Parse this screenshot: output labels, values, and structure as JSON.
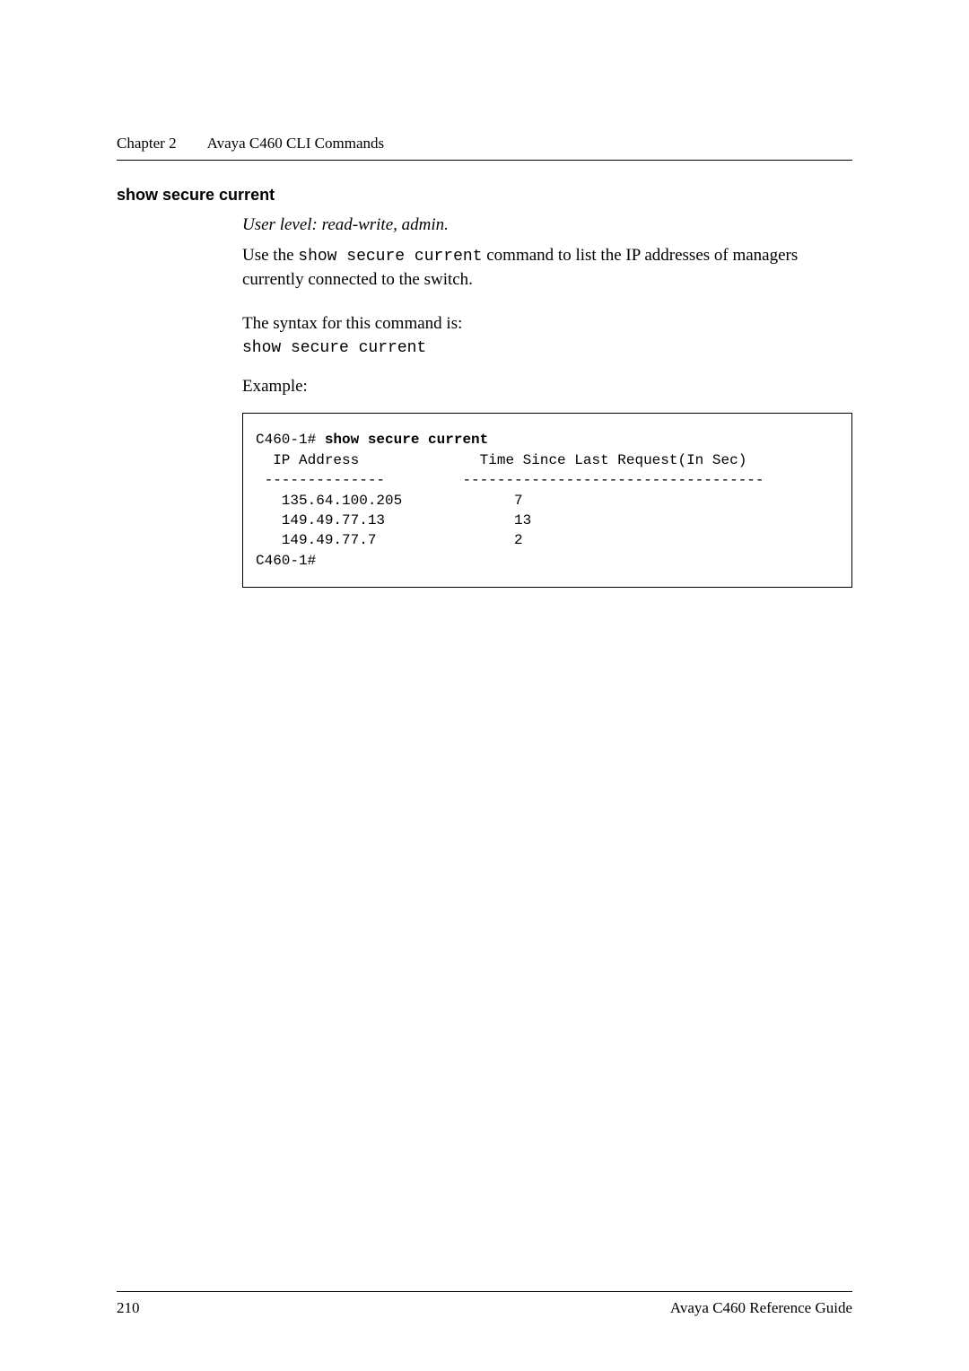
{
  "header": {
    "chapter": "Chapter 2",
    "title": "Avaya C460 CLI Commands"
  },
  "section": {
    "title": "show secure current",
    "user_level": "User level: read-write, admin.",
    "description_pre": "Use the ",
    "description_code": "show secure current",
    "description_post": " command to list the IP addresses of managers currently connected to the switch.",
    "syntax_label": "The syntax for this command is:",
    "syntax_code": "show secure current",
    "example_label": "Example:",
    "example": {
      "prompt1": "C460-1# ",
      "command": "show secure current",
      "col1_header": "  IP Address",
      "col2_header": "Time Since Last Request(In Sec)",
      "div1": " --------------         -----------------------------------",
      "row1": "   135.64.100.205             7",
      "row2": "   149.49.77.13               13",
      "row3": "   149.49.77.7                2",
      "prompt2": "C460-1#"
    }
  },
  "footer": {
    "page": "210",
    "doc": "Avaya C460 Reference Guide"
  }
}
